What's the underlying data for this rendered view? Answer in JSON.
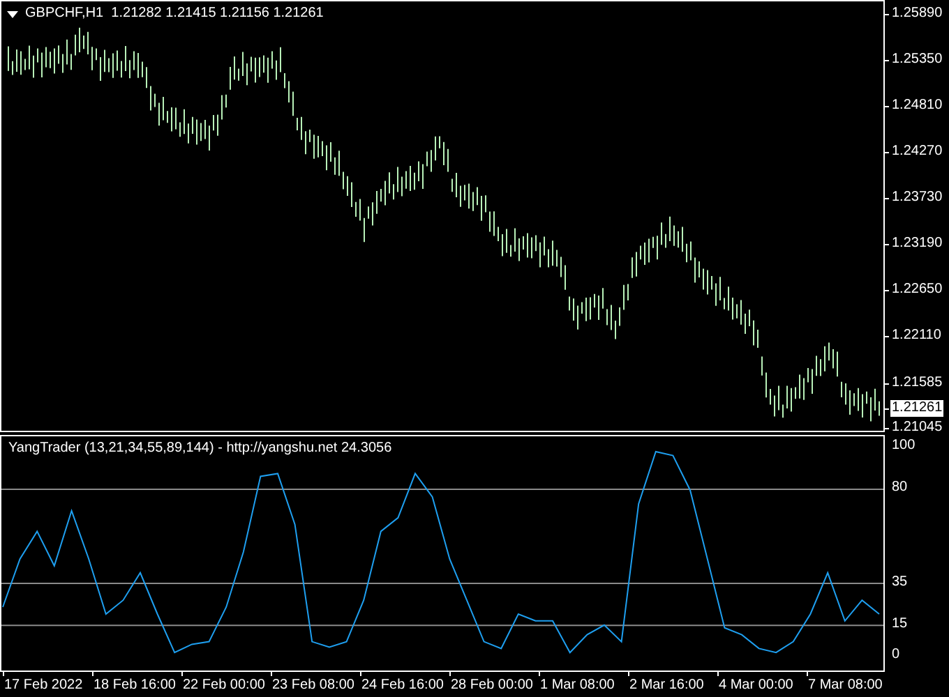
{
  "chart": {
    "title": "GBPCHF,H1  1.21282 1.21415 1.21156 1.21261"
  },
  "price_axis": [
    {
      "text": "1.25890",
      "current": false
    },
    {
      "text": "1.25350",
      "current": false
    },
    {
      "text": "1.24810",
      "current": false
    },
    {
      "text": "1.24270",
      "current": false
    },
    {
      "text": "1.23730",
      "current": false
    },
    {
      "text": "1.23190",
      "current": false
    },
    {
      "text": "1.22650",
      "current": false
    },
    {
      "text": "1.22110",
      "current": false
    },
    {
      "text": "1.21585",
      "current": false
    },
    {
      "text": "1.21261",
      "current": true
    },
    {
      "text": "1.21045",
      "current": false
    }
  ],
  "indicator": {
    "title": "YangTrader (13,21,34,55,89,144) - http://yangshu.net 24.3056",
    "chart_data": {
      "type": "line",
      "ylim": [
        -6.6,
        105.3
      ],
      "yticks": [
        100,
        80,
        35,
        15,
        0
      ],
      "categories": [
        null,
        null,
        null,
        null,
        null,
        null,
        null,
        null,
        null,
        null,
        null,
        null,
        null,
        null,
        null,
        null,
        null,
        null,
        null,
        null,
        null,
        null,
        null,
        null,
        null,
        null,
        null,
        null,
        null,
        null,
        null,
        null,
        null,
        null,
        null,
        null,
        null,
        null,
        null,
        null,
        null,
        null,
        null,
        null,
        null,
        null,
        null,
        null,
        null,
        null,
        null,
        null
      ],
      "series": [
        {
          "color": "#1e9ff0",
          "values": [
            23.7,
            46.7,
            59.9,
            43.4,
            69.7,
            46.7,
            20.4,
            27.0,
            40.1,
            20.4,
            2.0,
            5.9,
            7.2,
            23.7,
            50.0,
            86.2,
            87.5,
            63.2,
            7.2,
            4.6,
            7.2,
            27.0,
            59.9,
            66.4,
            87.5,
            76.3,
            46.7,
            27.0,
            7.2,
            3.9,
            20.4,
            17.1,
            17.1,
            2.0,
            10.5,
            15.1,
            7.2,
            73.0,
            98.0,
            96.1,
            79.6,
            46.7,
            13.8,
            10.5,
            3.9,
            2.0,
            7.2,
            20.4,
            40.1,
            17.1,
            27.0,
            20.4
          ]
        }
      ],
      "grid": true
    }
  },
  "time_axis": [
    "17 Feb 2022",
    "18 Feb 16:00",
    "22 Feb 00:00",
    "23 Feb 08:00",
    "24 Feb 16:00",
    "28 Feb 00:00",
    "1 Mar 08:00",
    "2 Mar 16:00",
    "4 Mar 00:00",
    "7 Mar 08:00"
  ]
}
